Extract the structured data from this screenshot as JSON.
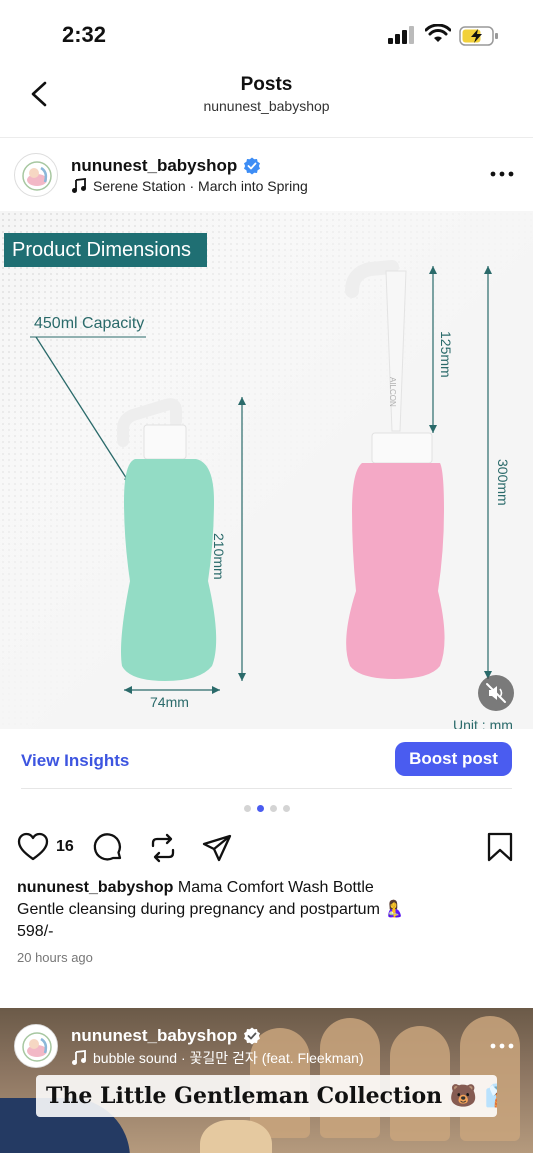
{
  "status_bar": {
    "time": "2:32"
  },
  "header": {
    "title": "Posts",
    "subtitle": "nununest_babyshop"
  },
  "post": {
    "username": "nununest_babyshop",
    "music": "Serene Station · March into Spring",
    "image": {
      "label": "Product Dimensions",
      "capacity": "450ml Capacity",
      "dim_width": "74mm",
      "dim_height_green": "210mm",
      "dim_nozzle": "125mm",
      "dim_total": "300mm",
      "brand_on_nozzle": "AILCON",
      "unit": "Unit : mm"
    },
    "insights_label": "View Insights",
    "boost_label": "Boost post",
    "carousel": {
      "count": 4,
      "active": 1
    },
    "likes": "16",
    "caption_user": "nununest_babyshop",
    "caption_line1": " Mama Comfort Wash Bottle",
    "caption_line2": "Gentle cleansing during pregnancy and postpartum 🤱",
    "caption_line3": "598/-",
    "time_ago": "20 hours ago"
  },
  "next_post": {
    "username": "nununest_babyshop",
    "music": "bubble sound · 꽃길만 걷자 (feat. Fleekman)",
    "banner": "The Little Gentleman Collection 🐻 👔"
  },
  "colors": {
    "accent": "#4a5cf0",
    "teal_label": "#1f6f73",
    "bottle_green": "#93dcc5",
    "bottle_pink": "#f4a9c6"
  }
}
